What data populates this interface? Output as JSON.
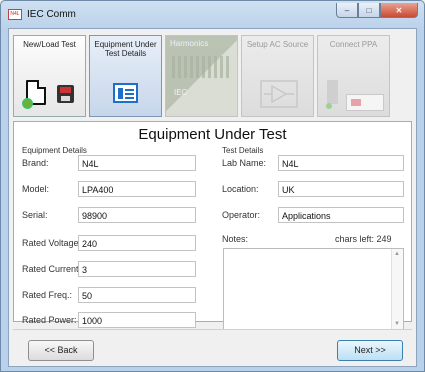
{
  "window": {
    "title": "IEC Comm",
    "app_icon_text": "N4L"
  },
  "steps": [
    {
      "label": "New/Load Test",
      "state": "enabled"
    },
    {
      "label": "Equipment Under Test Details",
      "state": "active"
    },
    {
      "label": "Harmonics",
      "sub": "IEC",
      "state": "disabled"
    },
    {
      "label": "Setup AC Source",
      "state": "disabled"
    },
    {
      "label": "Connect PPA",
      "state": "disabled"
    }
  ],
  "panel": {
    "title": "Equipment Under Test",
    "equipment_group": "Equipment Details",
    "test_group": "Test Details"
  },
  "equipment": {
    "brand_label": "Brand:",
    "brand": "N4L",
    "model_label": "Model:",
    "model": "LPA400",
    "serial_label": "Serial:",
    "serial": "98900",
    "voltage_label": "Rated Voltage:",
    "voltage": "240",
    "current_label": "Rated Current:",
    "current": "3",
    "freq_label": "Rated Freq.:",
    "freq": "50",
    "power_label": "Rated Power:",
    "power": "1000"
  },
  "test": {
    "lab_label": "Lab Name:",
    "lab": "N4L",
    "location_label": "Location:",
    "location": "UK",
    "operator_label": "Operator:",
    "operator": "Applications",
    "notes_label": "Notes:",
    "chars_left": "chars left: 249",
    "notes": ""
  },
  "buttons": {
    "back": "<< Back",
    "next": "Next >>"
  }
}
